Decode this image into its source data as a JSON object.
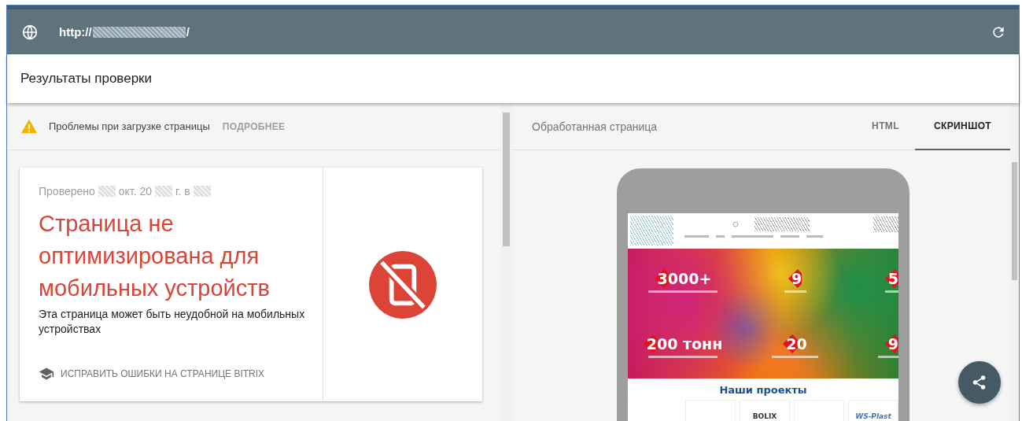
{
  "address_bar": {
    "url_prefix": "http://",
    "url_suffix": "/"
  },
  "header": {
    "title": "Результаты проверки"
  },
  "warning": {
    "text": "Проблемы при загрузке страницы",
    "link": "ПОДРОБНЕЕ"
  },
  "result": {
    "checked": [
      "Проверено",
      "окт. 20",
      "г. в"
    ],
    "title": "Страница не оптимизирована для мобильных устройств",
    "description": "Эта страница может быть неудобной на мобильных устройствах",
    "action": "ИСПРАВИТЬ ОШИБКИ НА СТРАНИЦЕ BITRIX"
  },
  "preview": {
    "title": "Обработанная страница",
    "tabs": [
      {
        "label": "HTML",
        "selected": false
      },
      {
        "label": "СКРИНШОТ",
        "selected": true
      }
    ],
    "site": {
      "stats": [
        {
          "value": "3000+"
        },
        {
          "value": "9"
        },
        {
          "value": "5"
        },
        {
          "value": "200 тонн"
        },
        {
          "value": "20"
        },
        {
          "value": "9"
        }
      ],
      "section_title": "Наши проекты",
      "partners": [
        {
          "kind": "blank"
        },
        {
          "kind": "logo",
          "text": "BOLIX"
        },
        {
          "kind": "blank"
        },
        {
          "kind": "logo",
          "text": "WS-Plast"
        }
      ]
    }
  }
}
